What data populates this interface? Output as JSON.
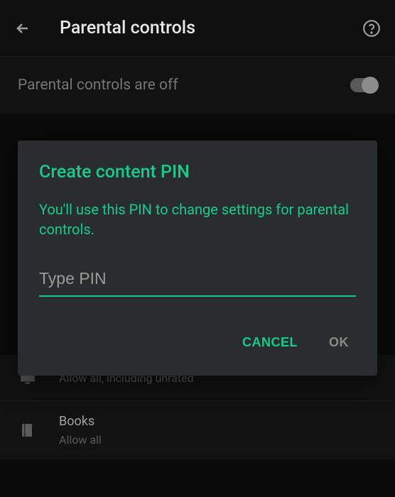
{
  "header": {
    "page_title": "Parental controls"
  },
  "status": {
    "text": "Parental controls are off",
    "toggle_on": false
  },
  "dialog": {
    "title": "Create content PIN",
    "body": "You'll use this PIN to change settings for parental controls.",
    "pin_placeholder": "Type PIN",
    "cancel_label": "CANCEL",
    "ok_label": "OK"
  },
  "categories": [
    {
      "title": "",
      "sub": "Allow all, including unrated",
      "icon": "tv"
    },
    {
      "title": "Books",
      "sub": "Allow all",
      "icon": "book"
    }
  ],
  "colors": {
    "accent": "#1bc98e",
    "dialog_bg": "#2a2d2e",
    "page_bg": "#0a0a0a"
  }
}
